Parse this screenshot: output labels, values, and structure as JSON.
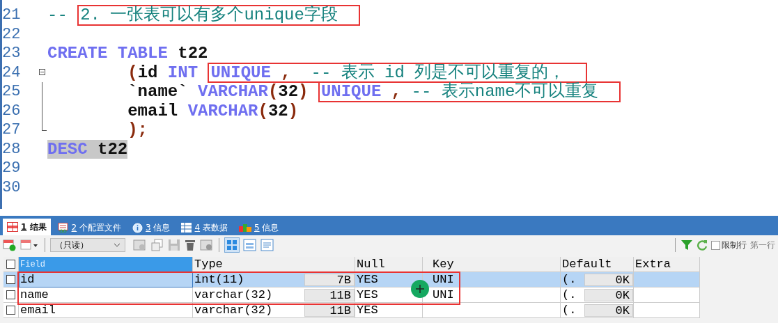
{
  "editor": {
    "lines": [
      {
        "number": "21",
        "kind": "plain",
        "highlighted": false,
        "tokens": [
          {
            "text": "-- ",
            "kind": "comment"
          }
        ],
        "boxed": [
          {
            "text": "2. 一张表可以有多个unique字段",
            "kind": "comment"
          }
        ]
      },
      {
        "number": "22",
        "kind": "plain",
        "highlighted": false
      },
      {
        "number": "23",
        "kind": "plain",
        "highlighted": false,
        "tokens": [
          {
            "text": "CREATE TABLE",
            "kind": "keyword"
          },
          {
            "text": " t22",
            "kind": "plain"
          }
        ]
      },
      {
        "number": "24",
        "kind": "open",
        "highlighted": false,
        "tokens": [
          {
            "text": "        (",
            "kind": "paren"
          },
          {
            "text": "id ",
            "kind": "plain"
          },
          {
            "text": "INT ",
            "kind": "keyword"
          }
        ],
        "boxed": [
          {
            "text": "UNIQUE",
            "kind": "keyword"
          },
          {
            "text": " ,  ",
            "kind": "paren"
          },
          {
            "text": "-- 表示 id 列是不可以重复的，",
            "kind": "comment"
          }
        ]
      },
      {
        "number": "25",
        "kind": "inner",
        "highlighted": false,
        "tokens": [
          {
            "text": "        `name` ",
            "kind": "plain"
          },
          {
            "text": "VARCHAR",
            "kind": "keyword"
          },
          {
            "text": "(",
            "kind": "paren"
          },
          {
            "text": "32",
            "kind": "plain"
          },
          {
            "text": ") ",
            "kind": "paren"
          }
        ],
        "boxed": [
          {
            "text": "UNIQUE",
            "kind": "keyword"
          },
          {
            "text": " , ",
            "kind": "paren"
          },
          {
            "text": "-- 表示name不可以重复",
            "kind": "comment"
          }
        ]
      },
      {
        "number": "26",
        "kind": "inner",
        "highlighted": false,
        "tokens": [
          {
            "text": "        email ",
            "kind": "plain"
          },
          {
            "text": "VARCHAR",
            "kind": "keyword"
          },
          {
            "text": "(",
            "kind": "paren"
          },
          {
            "text": "32",
            "kind": "plain"
          },
          {
            "text": ")",
            "kind": "paren"
          }
        ]
      },
      {
        "number": "27",
        "kind": "end",
        "highlighted": false,
        "tokens": [
          {
            "text": "        );",
            "kind": "paren"
          }
        ]
      },
      {
        "number": "28",
        "kind": "plain",
        "highlighted": true,
        "tokens": [
          {
            "text": "DESC",
            "kind": "keyword"
          },
          {
            "text": " t22",
            "kind": "plain"
          }
        ]
      },
      {
        "number": "29",
        "kind": "plain",
        "highlighted": false
      },
      {
        "number": "30",
        "kind": "plain",
        "highlighted": false
      }
    ]
  },
  "result_tabs": [
    {
      "number": "1",
      "label": "结果",
      "selected": true
    },
    {
      "number": "2",
      "label": "个配置文件",
      "selected": false
    },
    {
      "number": "3",
      "label": "信息",
      "selected": false
    },
    {
      "number": "4",
      "label": "表数据",
      "selected": false
    },
    {
      "number": "5",
      "label": "信息",
      "selected": false
    }
  ],
  "toolbar": {
    "mode_select": "（只读）",
    "limit_rows": {
      "label": "限制行",
      "checked": false
    },
    "first_row_label": "第一行"
  },
  "table": {
    "all_checked": false,
    "columns": [
      "Field",
      "Type",
      "Null",
      "Key",
      "Default",
      "Extra"
    ],
    "rows": [
      {
        "selected": true,
        "checked": false,
        "field": "id",
        "type": "int(11)",
        "size": "7B",
        "null": "YES",
        "key": "UNI",
        "default_prefix": "(.",
        "default": "0K"
      },
      {
        "selected": false,
        "checked": false,
        "field": "name",
        "type": "varchar(32)",
        "size": "11B",
        "null": "YES",
        "key": "UNI",
        "default_prefix": "(.",
        "default": "0K"
      },
      {
        "selected": false,
        "checked": false,
        "field": "email",
        "type": "varchar(32)",
        "size": "11B",
        "null": "YES",
        "default_prefix": "(.",
        "default": "0K"
      }
    ]
  }
}
